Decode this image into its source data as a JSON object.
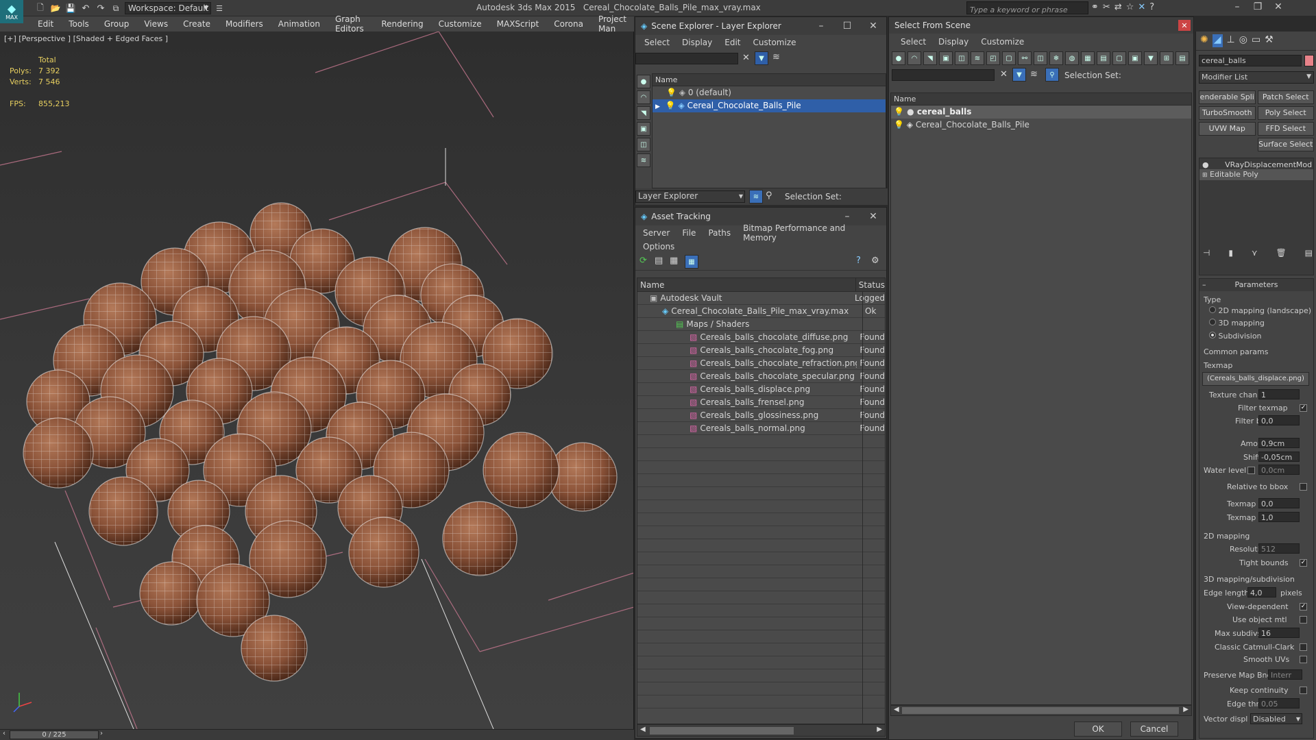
{
  "app": {
    "title": "Autodesk 3ds Max  2015",
    "file": "Cereal_Chocolate_Balls_Pile_max_vray.max",
    "logo": "MAX",
    "workspace": "Workspace: Default",
    "search_placeholder": "Type a keyword or phrase"
  },
  "menu": [
    "Edit",
    "Tools",
    "Group",
    "Views",
    "Create",
    "Modifiers",
    "Animation",
    "Graph Editors",
    "Rendering",
    "Customize",
    "MAXScript",
    "Corona",
    "Project Man"
  ],
  "viewport": {
    "label": "[+] [Perspective ] [Shaded + Edged Faces ]",
    "stats": {
      "total_label": "Total",
      "polys_label": "Polys:",
      "polys": "7 392",
      "verts_label": "Verts:",
      "verts": "7 546",
      "fps_label": "FPS:",
      "fps": "855,213"
    },
    "time": "0 / 225"
  },
  "scene_explorer": {
    "title": "Scene Explorer - Layer Explorer",
    "menu": [
      "Select",
      "Display",
      "Edit",
      "Customize"
    ],
    "col_name": "Name",
    "rows": [
      "0 (default)",
      "Cereal_Chocolate_Balls_Pile"
    ],
    "footer_dropdown": "Layer Explorer",
    "selection_set": "Selection Set:"
  },
  "asset_tracking": {
    "title": "Asset Tracking",
    "menu": [
      "Server",
      "File",
      "Paths",
      "Bitmap Performance and Memory"
    ],
    "menu2": "Options",
    "col_name": "Name",
    "col_status": "Status",
    "rows": [
      {
        "name": "Autodesk Vault",
        "status": "Logged"
      },
      {
        "name": "Cereal_Chocolate_Balls_Pile_max_vray.max",
        "status": "Ok"
      },
      {
        "name": "Maps / Shaders",
        "status": ""
      },
      {
        "name": "Cereals_balls_chocolate_diffuse.png",
        "status": "Found"
      },
      {
        "name": "Cereals_balls_chocolate_fog.png",
        "status": "Found"
      },
      {
        "name": "Cereals_balls_chocolate_refraction.png",
        "status": "Found"
      },
      {
        "name": "Cereals_balls_chocolate_specular.png",
        "status": "Found"
      },
      {
        "name": "Cereals_balls_displace.png",
        "status": "Found"
      },
      {
        "name": "Cereals_balls_frensel.png",
        "status": "Found"
      },
      {
        "name": "Cereals_balls_glossiness.png",
        "status": "Found"
      },
      {
        "name": "Cereals_balls_normal.png",
        "status": "Found"
      }
    ]
  },
  "select_from_scene": {
    "title": "Select From Scene",
    "menu": [
      "Select",
      "Display",
      "Customize"
    ],
    "selection_set": "Selection Set:",
    "col_name": "Name",
    "rows": [
      "cereal_balls",
      "Cereal_Chocolate_Balls_Pile"
    ],
    "ok": "OK",
    "cancel": "Cancel"
  },
  "command_panel": {
    "object_name": "cereal_balls",
    "modifier_list": "Modifier List",
    "buttons": [
      "enderable Spli",
      "Patch Select",
      "TurboSmooth",
      "Poly Select",
      "UVW Map",
      "FFD Select",
      "Surface Select"
    ],
    "stack": [
      "VRayDisplacementMod",
      "Editable Poly"
    ],
    "rollout": "Parameters",
    "type_label": "Type",
    "types": [
      "2D mapping (landscape)",
      "3D mapping",
      "Subdivision"
    ],
    "common_label": "Common params",
    "texmap_label": "Texmap",
    "texmap": "(Cereals_balls_displace.png)",
    "texture_chan": {
      "label": "Texture chan",
      "value": "1"
    },
    "filter_texmap": "Filter texmap",
    "filter_blur": {
      "label": "Filter blur",
      "value": "0,0"
    },
    "amount": {
      "label": "Amount",
      "value": "0,9cm"
    },
    "shift": {
      "label": "Shift",
      "value": "-0,05cm"
    },
    "water": {
      "label": "Water level",
      "value": "0,0cm"
    },
    "relative": "Relative to bbox",
    "tmin": {
      "label": "Texmap min",
      "value": "0,0"
    },
    "tmax": {
      "label": "Texmap max",
      "value": "1,0"
    },
    "map2d_label": "2D mapping",
    "resolution": {
      "label": "Resolution",
      "value": "512"
    },
    "tight": "Tight bounds",
    "map3d_label": "3D mapping/subdivision",
    "edge_length": {
      "label": "Edge length",
      "value": "4,0",
      "unit": "pixels"
    },
    "view_dep": "View-dependent",
    "use_obj": "Use object mtl",
    "max_subdivs": {
      "label": "Max subdivs",
      "value": "16"
    },
    "classic": "Classic Catmull-Clark",
    "smooth_uv": "Smooth UVs",
    "preserve": {
      "label": "Preserve Map Bnd",
      "value": "Interr"
    },
    "keep": "Keep continuity",
    "edge_thresh": {
      "label": "Edge thresh",
      "value": "0,05"
    },
    "vector": {
      "label": "Vector displ",
      "value": "Disabled"
    }
  }
}
